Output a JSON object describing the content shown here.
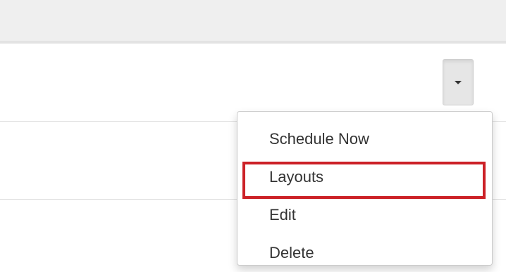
{
  "toolbar": {
    "toggle_icon": "caret-down-icon"
  },
  "dropdown": {
    "items": [
      {
        "label": "Schedule Now"
      },
      {
        "label": "Layouts"
      },
      {
        "label": "Edit"
      },
      {
        "label": "Delete"
      }
    ],
    "highlighted_item": "Layouts",
    "highlight_color": "#cc2127"
  }
}
